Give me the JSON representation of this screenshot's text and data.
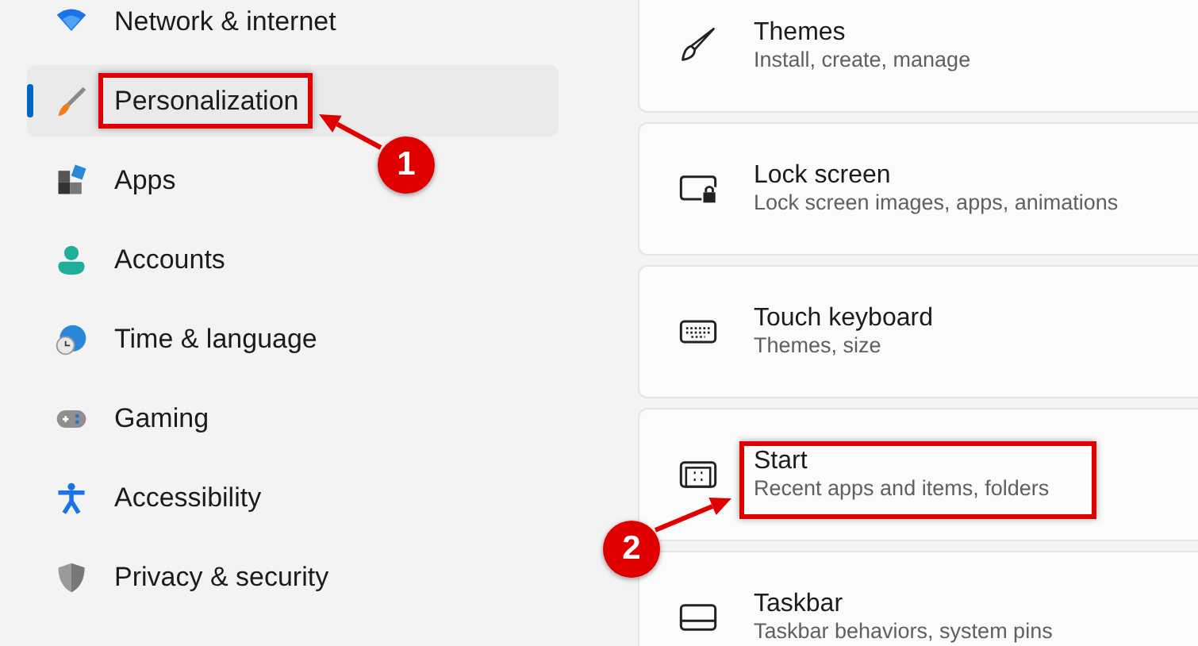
{
  "sidebar": {
    "items": [
      {
        "label": "Network & internet",
        "selected": false
      },
      {
        "label": "Personalization",
        "selected": true
      },
      {
        "label": "Apps",
        "selected": false
      },
      {
        "label": "Accounts",
        "selected": false
      },
      {
        "label": "Time & language",
        "selected": false
      },
      {
        "label": "Gaming",
        "selected": false
      },
      {
        "label": "Accessibility",
        "selected": false
      },
      {
        "label": "Privacy & security",
        "selected": false
      }
    ]
  },
  "settings": [
    {
      "title": "Themes",
      "subtitle": "Install, create, manage"
    },
    {
      "title": "Lock screen",
      "subtitle": "Lock screen images, apps, animations"
    },
    {
      "title": "Touch keyboard",
      "subtitle": "Themes, size"
    },
    {
      "title": "Start",
      "subtitle": "Recent apps and items, folders"
    },
    {
      "title": "Taskbar",
      "subtitle": "Taskbar behaviors, system pins"
    }
  ],
  "annotations": [
    {
      "number": "1"
    },
    {
      "number": "2"
    }
  ]
}
